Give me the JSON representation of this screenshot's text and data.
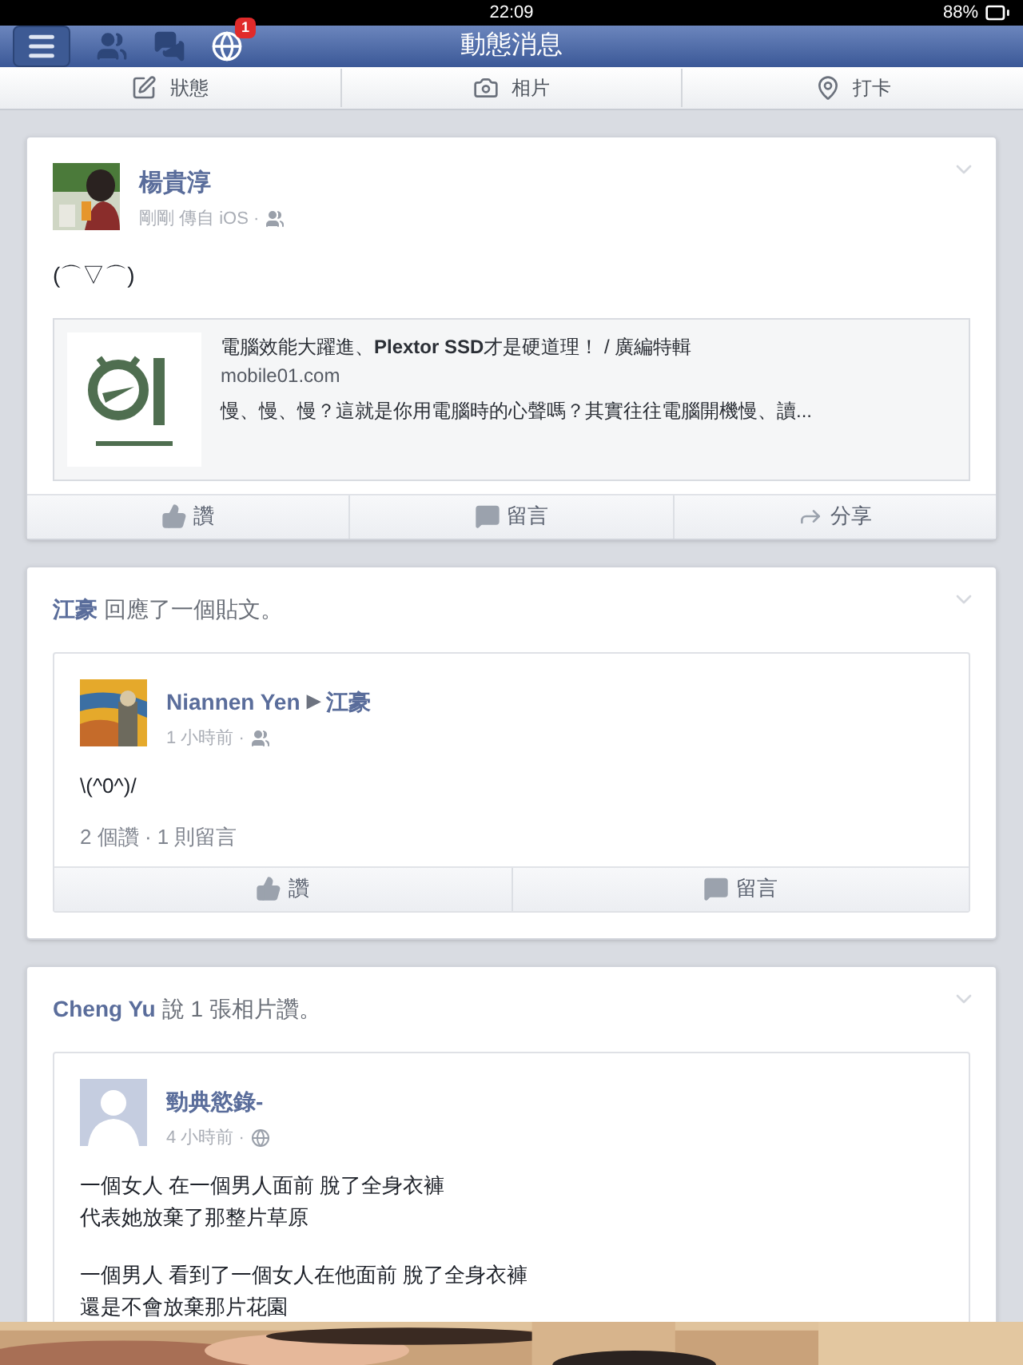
{
  "status_bar": {
    "time": "22:09",
    "battery": "88%"
  },
  "nav": {
    "title": "動態消息",
    "badge": "1"
  },
  "composer": [
    {
      "kind": "status",
      "label": "狀態"
    },
    {
      "label": "相片"
    },
    {
      "kind": "checkin",
      "label": "打卡"
    }
  ],
  "feed": [
    {
      "kind": "post",
      "author": "楊貴淳",
      "meta": "剛剛 傳自 iOS ·",
      "audience": {
        "kind": "friends"
      },
      "text": "(⌒▽⌒)",
      "link": {
        "title": "電腦效能大躍進、**Plextor SSD**才是硬道理！ / 廣編特輯",
        "domain": "mobile01.com",
        "description": "慢、慢、慢？這就是你用電腦時的心聲嗎？其實往往電腦開機慢、讀..."
      },
      "actions": [
        {
          "kind": "like",
          "label": "讚"
        },
        {
          "kind": "comment",
          "label": "留言"
        },
        {
          "kind": "share",
          "label": "分享"
        }
      ]
    },
    {
      "kind": "activity",
      "actor": "江豪",
      "header": "回應了一個貼文。",
      "inner": {
        "author": "Niannen Yen",
        "arrow": "▶",
        "target": "江豪",
        "meta": "1 小時前 ·",
        "audience": {
          "kind": "friends"
        },
        "avatar": {
          "kind": "painting"
        },
        "paragraphs": [
          [
            "\\(^0^)/"
          ]
        ],
        "stats": "2 個讚 · 1 則留言",
        "actions": [
          {
            "kind": "like",
            "label": "讚"
          },
          {
            "kind": "comment",
            "label": "留言"
          }
        ]
      }
    },
    {
      "kind": "activity",
      "actor": "Cheng Yu",
      "header": "說 1 張相片讚。",
      "inner": {
        "author": "勁典慾錄-",
        "meta": "4 小時前 ·",
        "audience": {
          "kind": "public"
        },
        "avatar": {
          "kind": "silhouette"
        },
        "paragraphs": [
          [
            "一個女人 在一個男人面前 脫了全身衣褲",
            "代表她放棄了那整片草原"
          ],
          [
            "一個男人 看到了一個女人在他面前 脫了全身衣褲",
            "還是不會放棄那片花園"
          ]
        ],
        "photo": {
          "kind": "picture"
        }
      }
    }
  ]
}
